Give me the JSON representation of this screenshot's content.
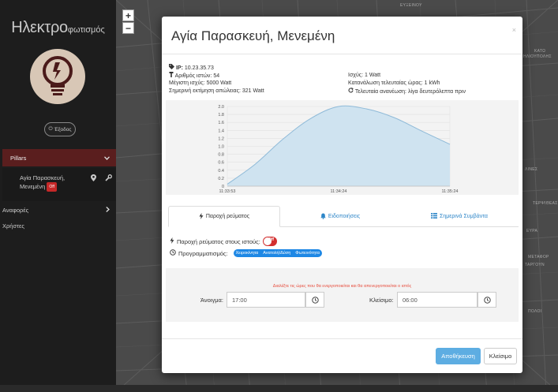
{
  "sidebar": {
    "brand_big": "Ηλεκτρο",
    "brand_small": "φωτισμός",
    "logout": "Έξοδος",
    "nav": {
      "pillars": "Pillars",
      "pillar_name_line1": "Αγία Παρασκευή,",
      "pillar_name_line2": "Μενεμένη",
      "pillar_badge": "Off",
      "reports": "Αναφορές",
      "users": "Χρήστες"
    }
  },
  "map": {
    "zoom_in": "+",
    "zoom_out": "−",
    "labels": [
      "ΕΥΞΕΙΝΟΥ",
      "ΚΑΤΩ",
      "ΗΛΙΟΥΠΟΛΗΣ",
      "ΛΙΝΕΣ",
      "ΤΕΡΨΙΘΕΑΣ",
      "ΕΥΡΑ",
      "ΜΕΤΑΦΟΡ",
      "ΤΑΡΓΟΥΝ",
      "ΠΟΛΟΙ"
    ]
  },
  "modal": {
    "title": "Αγία Παρασκευή, Μενεμένη",
    "close": "×",
    "info_left": [
      {
        "label": "IP:",
        "value": "10.23.35.73"
      },
      {
        "label": "Αριθμός ιστών:",
        "value": "54"
      },
      {
        "label": "Μέγιστη ισχύς:",
        "value": "5000 Watt"
      },
      {
        "label": "Σημερινή εκτίμηση απώλειας:",
        "value": "321 Watt"
      }
    ],
    "info_right": [
      {
        "label": "Ισχύς:",
        "value": "1 Watt"
      },
      {
        "label": "Κατανάλωση τελευταίας ώρας:",
        "value": "1 kWh"
      },
      {
        "label": "Τελευταία ανανέωση:",
        "value": "λίγα δευτερόλεπτα πριν"
      }
    ],
    "chart_data": {
      "type": "area",
      "x": [
        "11:33:53",
        "11:34:24",
        "11:35:24"
      ],
      "y_ticks": [
        0,
        0.2,
        0.4,
        0.6,
        0.8,
        1.0,
        1.2,
        1.4,
        1.6,
        1.8,
        2.0
      ],
      "ylim": [
        0,
        2.0
      ],
      "series": [
        {
          "points": [
            [
              0,
              0.05
            ],
            [
              0.125,
              0.55
            ],
            [
              0.25,
              1.18
            ],
            [
              0.375,
              1.7
            ],
            [
              0.5,
              2.0
            ],
            [
              0.625,
              1.94
            ],
            [
              0.75,
              1.72
            ],
            [
              0.875,
              1.38
            ],
            [
              1,
              1.05
            ]
          ]
        }
      ],
      "colors": {
        "fill": "#cfe3f0",
        "line": "#8fbad8"
      }
    },
    "tabs": [
      {
        "label": "Παροχή ρεύματος",
        "icon": "bolt-icon",
        "active": true
      },
      {
        "label": "Ειδοποιήσεις",
        "icon": "bell-icon",
        "active": false
      },
      {
        "label": "Σημερινά Συμβάντα",
        "icon": "list-icon",
        "active": false
      }
    ],
    "power": {
      "label": "Παροχή ρεύματος στους ιστούς:",
      "toggle": "Off"
    },
    "schedule": {
      "label": "Προγραμματισμός:",
      "options": [
        "Χειροκίνητα",
        "Ανατολή/Δύση",
        "Φωτεινότητα"
      ]
    },
    "times": {
      "hint": "Διαλέξτε τις ώρες που θα ενεργοποιείται και θα απενεργοποιείται ο ιστός",
      "open_label": "Άνοιγμα:",
      "open_value": "17:00",
      "close_label": "Κλείσιμο:",
      "close_value": "06:00"
    },
    "footer": {
      "save": "Αποθήκευση",
      "close": "Κλείσιμο"
    }
  },
  "colors": {
    "accent": "#2e86c8",
    "danger": "#d32f2f",
    "sidebar_bg": "#1d1d1d",
    "nav_active": "#5a1e1e",
    "save_btn": "#5dade2"
  }
}
